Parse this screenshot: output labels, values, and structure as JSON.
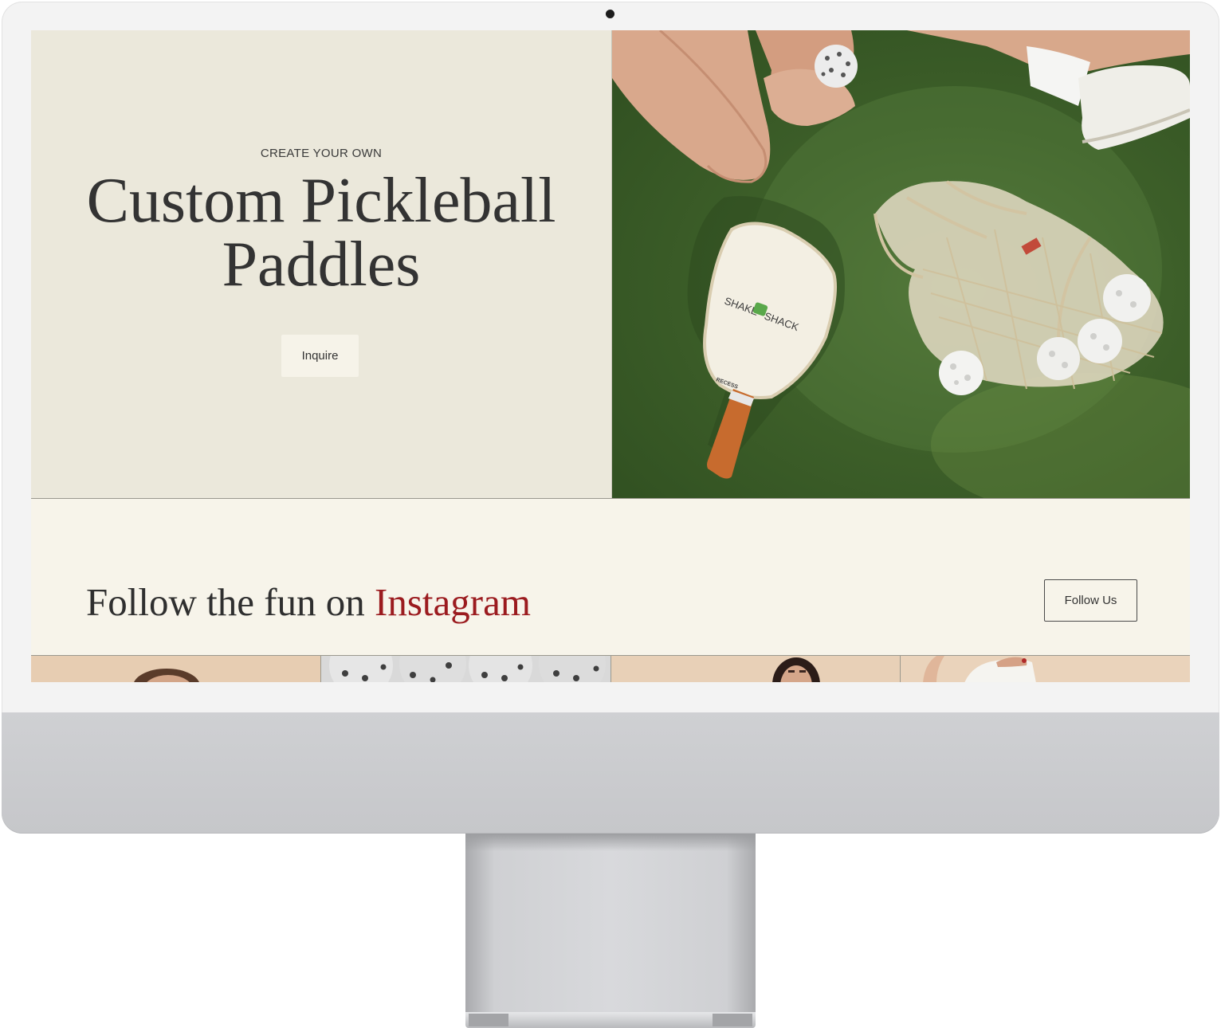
{
  "hero": {
    "eyebrow": "CREATE YOUR OWN",
    "title_line1": "Custom Pickleball",
    "title_line2": "Paddles",
    "inquire_label": "Inquire",
    "paddle_logo_line1": "SHAKE",
    "paddle_logo_line2": "SHACK",
    "paddle_brand": "RECESS"
  },
  "instagram": {
    "heading_prefix": "Follow the fun on",
    "heading_highlight": "Instagram",
    "follow_label": "Follow Us"
  },
  "gallery": {
    "tiles": [
      "person-photo",
      "pickleballs-photo",
      "person-photo",
      "hand-photo"
    ]
  },
  "colors": {
    "hero_left_bg": "#ebe8db",
    "page_bg": "#f7f4ea",
    "court_green": "#3d5f29",
    "accent_red": "#9b1b1f",
    "text_dark": "#333333"
  }
}
